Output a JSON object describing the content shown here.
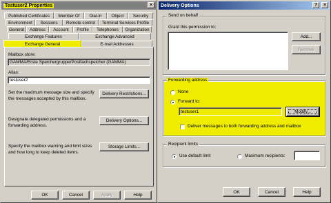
{
  "props": {
    "title": "Testuser2 Properties",
    "close": "×",
    "tabs_row1": [
      "Published Certificates",
      "Member Of",
      "Dial-in",
      "Object",
      "Security"
    ],
    "tabs_row2": [
      "Environment",
      "Sessions",
      "Remote control",
      "Terminal Services Profile"
    ],
    "tabs_row3": [
      "General",
      "Address",
      "Account",
      "Profile",
      "Telephones",
      "Organization"
    ],
    "tabs_row4": [
      "Exchange Features",
      "Exchange Advanced"
    ],
    "tabs_row5": [
      "Exchange General",
      "E-mail Addresses"
    ],
    "mailbox_store_label": "Mailbox store:",
    "mailbox_store_value": "GAMMA/Erste Speichergruppe/Postfachspeicher (GAMMA)",
    "alias_label": "Alias:",
    "alias_value": "testuser2",
    "delivery_restrictions_text": "Set the maximum message size and specify the messages accepted by this mailbox.",
    "delivery_restrictions_button": "Delivery Restrictions...",
    "delivery_options_text": "Designate delegated permissions and a forwarding address.",
    "delivery_options_button": "Delivery Options...",
    "storage_limits_text": "Specify the mailbox warning and limit sizes and how long to keep deleted items.",
    "storage_limits_button": "Storage Limits...",
    "ok": "OK",
    "cancel": "Cancel",
    "apply": "Apply",
    "help": "Help"
  },
  "delivery": {
    "title": "Delivery Options",
    "help_btn": "?",
    "close": "×",
    "send_on_behalf_legend": "Send on behalf",
    "grant_label": "Grant this permission to:",
    "add_button": "Add...",
    "remove_button": "Remove",
    "forwarding_legend": "Forwarding address",
    "none_label": "None",
    "forward_to_label": "Forward to:",
    "forward_to_value": "testuser1",
    "modify_button": "Modify...",
    "deliver_both_label": "Deliver messages to both forwarding address and mailbox",
    "recipient_limits_legend": "Recipient limits",
    "use_default_label": "Use default limit",
    "max_recipients_label": "Maximum recipients:",
    "max_recipients_value": "",
    "ok": "OK",
    "cancel": "Cancel",
    "help": "Help"
  },
  "colors": {
    "highlight": "#f0ec00",
    "title_active": "#0a246a",
    "title_active_end": "#a6caf0",
    "title_inactive": "#808080"
  }
}
